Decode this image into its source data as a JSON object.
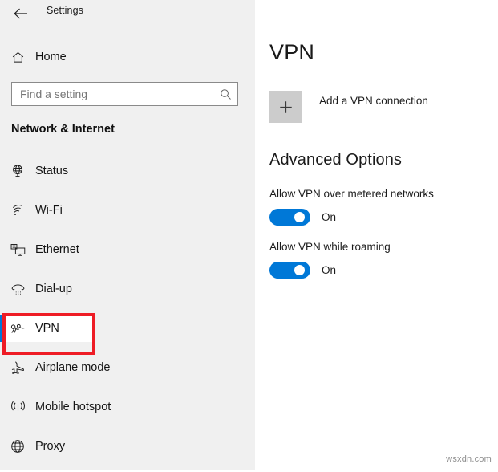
{
  "window": {
    "app_title": "Settings",
    "back_icon": "back-arrow-icon"
  },
  "sidebar": {
    "home": {
      "label": "Home",
      "icon": "home-icon"
    },
    "search": {
      "placeholder": "Find a setting",
      "value": "",
      "icon": "search-icon"
    },
    "section_heading": "Network & Internet",
    "items": [
      {
        "label": "Status",
        "icon": "globe-status-icon",
        "selected": false
      },
      {
        "label": "Wi-Fi",
        "icon": "wifi-icon",
        "selected": false
      },
      {
        "label": "Ethernet",
        "icon": "ethernet-icon",
        "selected": false
      },
      {
        "label": "Dial-up",
        "icon": "dialup-phone-icon",
        "selected": false
      },
      {
        "label": "VPN",
        "icon": "vpn-key-icon",
        "selected": true
      },
      {
        "label": "Airplane mode",
        "icon": "airplane-icon",
        "selected": false
      },
      {
        "label": "Mobile hotspot",
        "icon": "hotspot-icon",
        "selected": false
      },
      {
        "label": "Proxy",
        "icon": "globe-proxy-icon",
        "selected": false
      }
    ],
    "accent_color": "#0078d7",
    "highlight_color": "#ee1c25"
  },
  "main": {
    "page_title": "VPN",
    "add_connection": {
      "label": "Add a VPN connection",
      "icon": "plus-icon"
    },
    "advanced_heading": "Advanced Options",
    "settings": [
      {
        "label": "Allow VPN over metered networks",
        "state": "On",
        "on": true
      },
      {
        "label": "Allow VPN while roaming",
        "state": "On",
        "on": true
      }
    ]
  },
  "watermark": "wsxdn.com"
}
